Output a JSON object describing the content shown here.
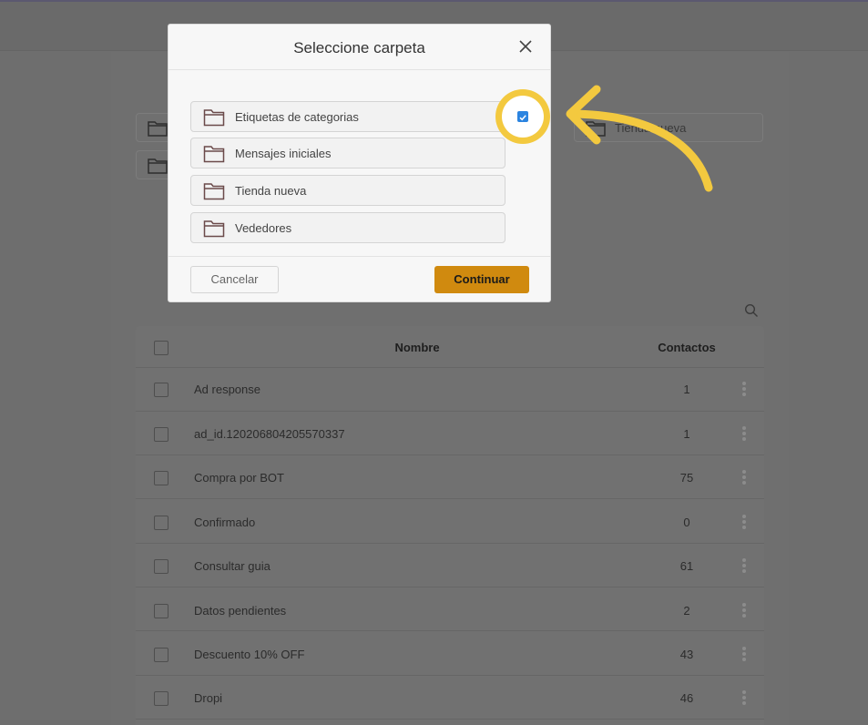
{
  "background_folders": [
    "Tienda nueva"
  ],
  "table": {
    "header": {
      "name": "Nombre",
      "contacts": "Contactos"
    },
    "rows": [
      {
        "name": "Ad response",
        "count": "1"
      },
      {
        "name": "ad_id.120206804205570337",
        "count": "1"
      },
      {
        "name": "Compra por BOT",
        "count": "75"
      },
      {
        "name": "Confirmado",
        "count": "0"
      },
      {
        "name": "Consultar guia",
        "count": "61"
      },
      {
        "name": "Datos pendientes",
        "count": "2"
      },
      {
        "name": "Descuento 10% OFF",
        "count": "43"
      },
      {
        "name": "Dropi",
        "count": "46"
      }
    ]
  },
  "modal": {
    "title": "Seleccione carpeta",
    "folders": [
      "Etiquetas de categorias",
      "Mensajes iniciales",
      "Tienda nueva",
      "Vededores"
    ],
    "cancel_label": "Cancelar",
    "continue_label": "Continuar"
  },
  "colors": {
    "accent": "#d08a0f",
    "highlight": "#f3c93f",
    "checkbox": "#2b84e0"
  },
  "icons": {
    "folder": "folder-icon",
    "close": "close-icon",
    "search": "search-icon",
    "more": "kebab-icon",
    "pointer": "arrow-icon"
  }
}
